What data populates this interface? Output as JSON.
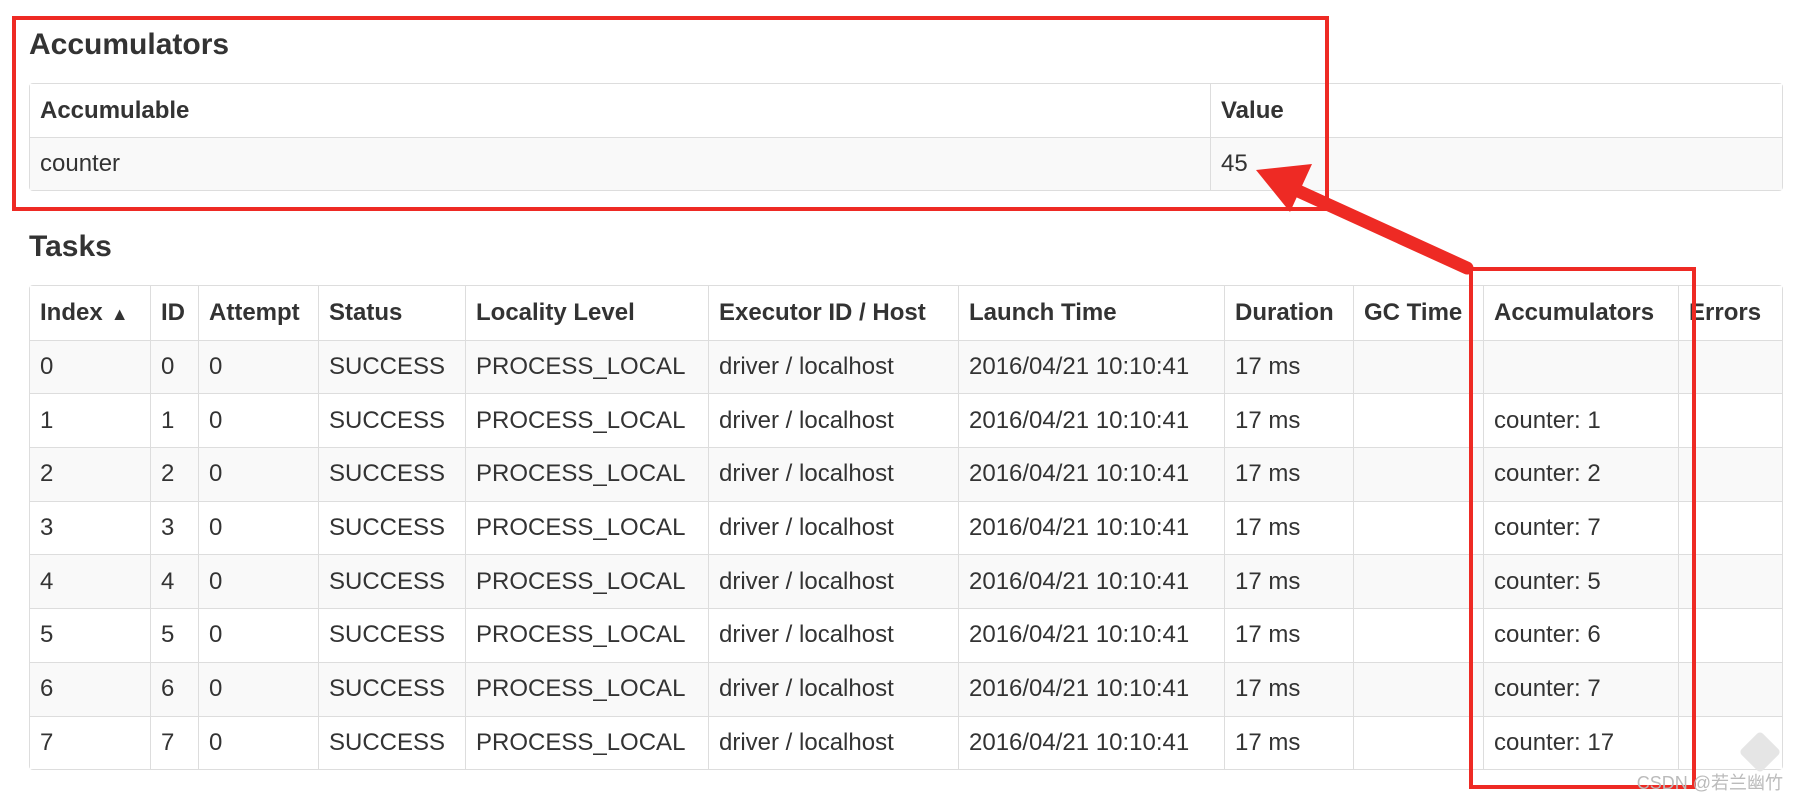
{
  "accumulators_section": {
    "title": "Accumulators",
    "columns": [
      "Accumulable",
      "Value"
    ],
    "rows": [
      {
        "name": "counter",
        "value": "45"
      }
    ]
  },
  "tasks_section": {
    "title": "Tasks",
    "sort_indicator": "▲",
    "columns": [
      "Index",
      "ID",
      "Attempt",
      "Status",
      "Locality Level",
      "Executor ID / Host",
      "Launch Time",
      "Duration",
      "GC Time",
      "Accumulators",
      "Errors"
    ],
    "rows": [
      [
        "0",
        "0",
        "0",
        "SUCCESS",
        "PROCESS_LOCAL",
        "driver / localhost",
        "2016/04/21 10:10:41",
        "17 ms",
        "",
        "",
        ""
      ],
      [
        "1",
        "1",
        "0",
        "SUCCESS",
        "PROCESS_LOCAL",
        "driver / localhost",
        "2016/04/21 10:10:41",
        "17 ms",
        "",
        "counter: 1",
        ""
      ],
      [
        "2",
        "2",
        "0",
        "SUCCESS",
        "PROCESS_LOCAL",
        "driver / localhost",
        "2016/04/21 10:10:41",
        "17 ms",
        "",
        "counter: 2",
        ""
      ],
      [
        "3",
        "3",
        "0",
        "SUCCESS",
        "PROCESS_LOCAL",
        "driver / localhost",
        "2016/04/21 10:10:41",
        "17 ms",
        "",
        "counter: 7",
        ""
      ],
      [
        "4",
        "4",
        "0",
        "SUCCESS",
        "PROCESS_LOCAL",
        "driver / localhost",
        "2016/04/21 10:10:41",
        "17 ms",
        "",
        "counter: 5",
        ""
      ],
      [
        "5",
        "5",
        "0",
        "SUCCESS",
        "PROCESS_LOCAL",
        "driver / localhost",
        "2016/04/21 10:10:41",
        "17 ms",
        "",
        "counter: 6",
        ""
      ],
      [
        "6",
        "6",
        "0",
        "SUCCESS",
        "PROCESS_LOCAL",
        "driver / localhost",
        "2016/04/21 10:10:41",
        "17 ms",
        "",
        "counter: 7",
        ""
      ],
      [
        "7",
        "7",
        "0",
        "SUCCESS",
        "PROCESS_LOCAL",
        "driver / localhost",
        "2016/04/21 10:10:41",
        "17 ms",
        "",
        "counter: 17",
        ""
      ]
    ]
  },
  "colors": {
    "annotation": "#ee2a24",
    "border": "#dddddd",
    "stripe": "#f9f9f9"
  },
  "watermark": "CSDN @若兰幽竹"
}
